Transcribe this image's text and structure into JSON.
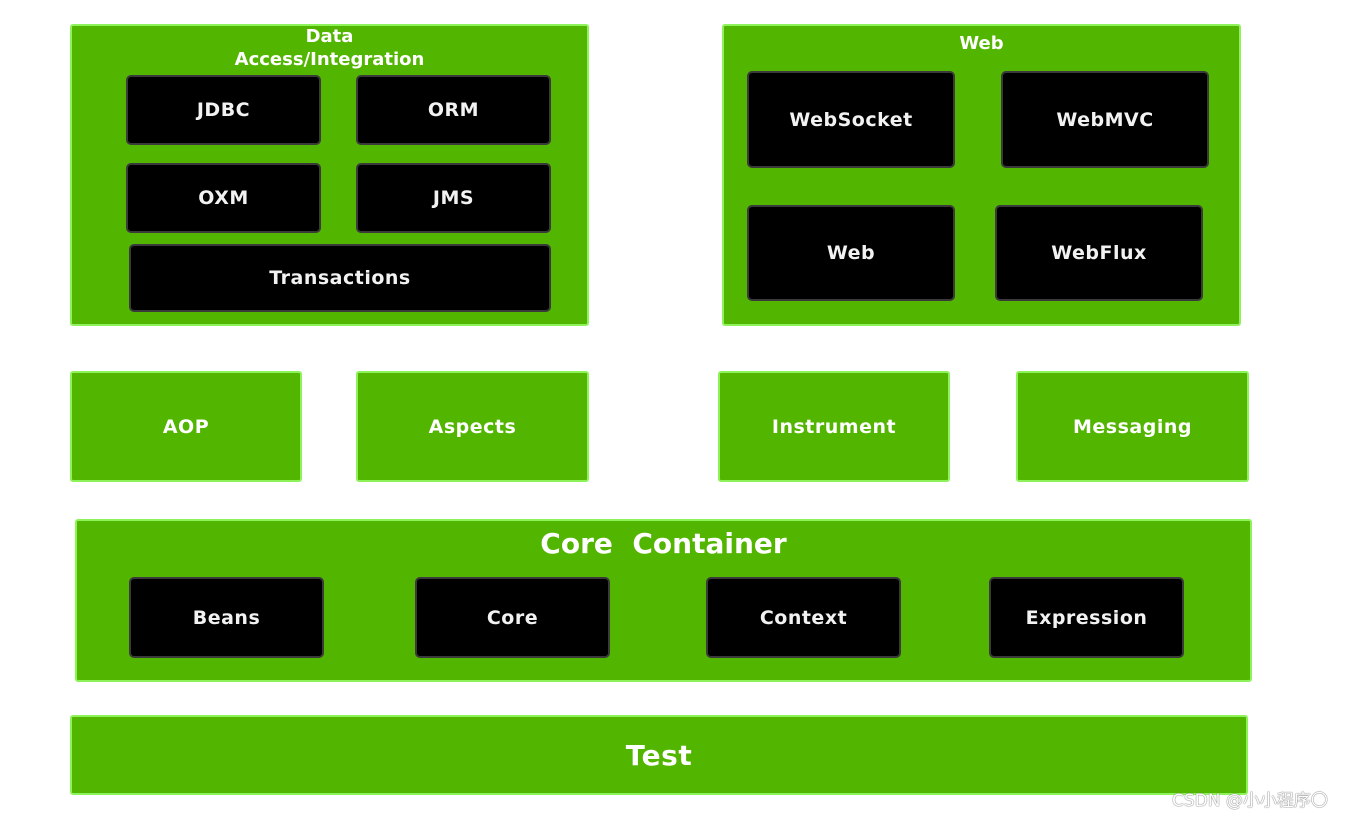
{
  "data_access": {
    "title_line1": "Data",
    "title_line2": "Access/Integration",
    "items": [
      "JDBC",
      "ORM",
      "OXM",
      "JMS",
      "Transactions"
    ]
  },
  "web": {
    "title": "Web",
    "items": [
      "WebSocket",
      "WebMVC",
      "Web",
      "WebFlux"
    ]
  },
  "middle": [
    "AOP",
    "Aspects",
    "Instrument",
    "Messaging"
  ],
  "core": {
    "title": "Core  Container",
    "items": [
      "Beans",
      "Core",
      "Context",
      "Expression"
    ]
  },
  "test": {
    "title": "Test"
  },
  "watermark": "CSDN @小小程序〇",
  "colors": {
    "module_green": "#52b500",
    "module_border": "#8ef25a",
    "component_black": "#000000"
  }
}
